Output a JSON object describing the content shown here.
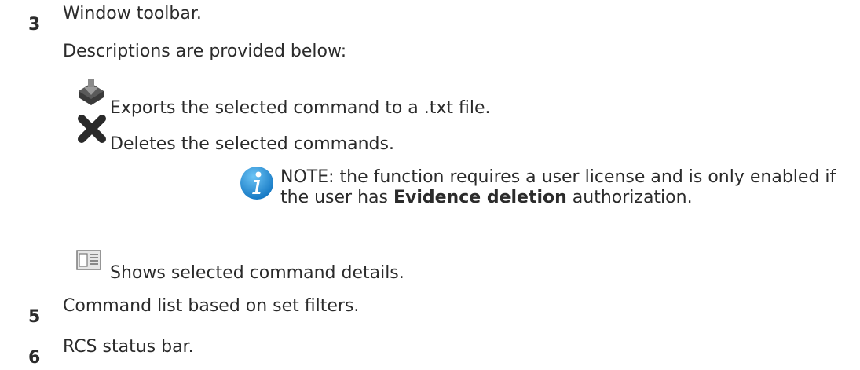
{
  "items": [
    {
      "number": "3",
      "title": "Window toolbar.",
      "subtitle": "Descriptions are provided below:"
    },
    {
      "number": "5",
      "title": "Command list based on set filters."
    },
    {
      "number": "6",
      "title": "RCS status bar."
    }
  ],
  "toolbar_items": [
    {
      "icon": "export-icon",
      "text": "Exports the selected command to a .txt file."
    },
    {
      "icon": "delete-icon",
      "text": "Deletes the selected commands."
    },
    {
      "icon": "details-icon",
      "text": "Shows selected command details."
    }
  ],
  "note": {
    "icon": "info-icon",
    "line1": "NOTE: the function requires a user license and is only enabled if",
    "line2_prefix": "the user has ",
    "line2_bold": "Evidence deletion",
    "line2_suffix": " authorization."
  },
  "colors": {
    "text": "#2b2b2b",
    "info_blue": "#1e8fd8",
    "icon_dark": "#333333"
  }
}
